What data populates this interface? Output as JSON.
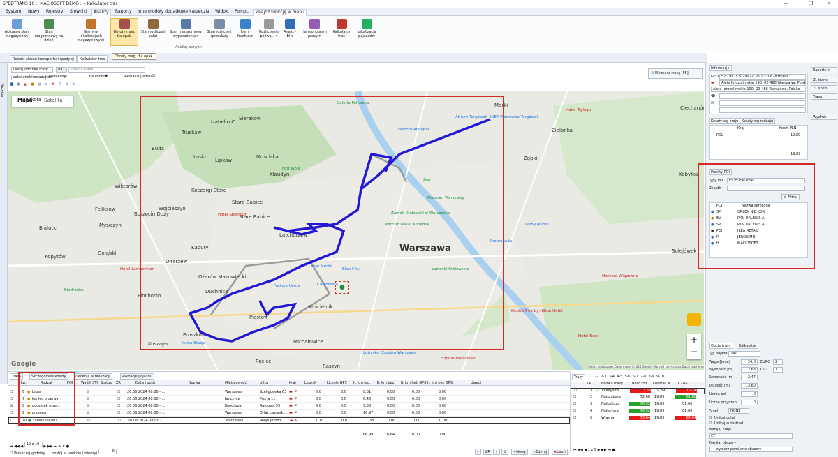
{
  "app": {
    "title": "SPEDTRANS 10 :: MACIOSOFT DEMO :: - Kalkulator tras"
  },
  "menu": {
    "tabs": [
      "System",
      "Nowy",
      "Rejestry",
      "Słowniki",
      "Analizy",
      "Raporty",
      "Inne moduły dodatkowe",
      "Narzędzia",
      "Widok",
      "Pomoc",
      "Znajdź funkcję w menu"
    ],
    "active": "Analizy"
  },
  "ribbon": {
    "buttons": [
      {
        "label": "Aktualny stan magazynowy",
        "icon": "warehouse-icon"
      },
      {
        "label": "Stan magazynowy na dzień",
        "icon": "calendar-warehouse-icon"
      },
      {
        "label": "Stany w lokalizacjach magazynowych",
        "icon": "locations-icon"
      },
      {
        "label": "Obroty mag. dla opak.",
        "icon": "package-turnover-icon"
      },
      {
        "label": "Stan rozliczeń palet",
        "icon": "pallet-icon"
      },
      {
        "label": "Stan magazynowy wyposażenia ▾",
        "icon": "equipment-icon"
      },
      {
        "label": "Stan rozliczeń sprzedaży",
        "icon": "sales-settlement-icon"
      },
      {
        "label": "Ceny frachtów",
        "icon": "freight-price-icon"
      },
      {
        "label": "Rozliczenie paliwa... ▾",
        "icon": "fuel-icon"
      },
      {
        "label": "Analizy BI ▾",
        "icon": "bi-icon"
      },
      {
        "label": "Harmonogram pracy ▾",
        "icon": "schedule-icon"
      },
      {
        "label": "Kalkulator tras",
        "icon": "route-calculator-icon"
      },
      {
        "label": "Lokalizacja pojazdów",
        "icon": "vehicle-location-icon"
      }
    ],
    "group_label": "Analizy danych",
    "tooltip": "Obroty mag. dla opak."
  },
  "doc_tabs": [
    "Rejestr zleceń transportu i spedycji",
    "Kalkulator tras"
  ],
  "left_strip_label": "Pojazdy",
  "route_toolbar": {
    "add_point": "Dodaj odcinek trasy",
    "search_placeholder": "Znajdź adres",
    "mode": "załadunek/rozładunek",
    "option_between": "pomiędzy",
    "option_end": "na końcu",
    "update_address": "Aktualizuj adres",
    "calc_button": "Wyznacz trasę [F5]"
  },
  "map": {
    "tab_map": "Mapa",
    "tab_satellite": "Satelita",
    "main_city": "Warszawa",
    "attribution": "Skróty klawiszowe   Dane mapy ©2024 Google   Warunki korzystania   Zgłoś błąd w mapach",
    "google": "Google",
    "labels": [
      {
        "t": "Rozkoła"
      },
      {
        "t": "Truskaw"
      },
      {
        "t": "Izabelin C"
      },
      {
        "t": "Sieraków"
      },
      {
        "t": "Laski"
      },
      {
        "t": "Lipków"
      },
      {
        "t": "Buda"
      },
      {
        "t": "Borzęcin Duży"
      },
      {
        "t": "Wojcieszyn"
      },
      {
        "t": "Stare Babice"
      },
      {
        "t": "Klaudyn"
      },
      {
        "t": "Koczargi Stare"
      },
      {
        "t": "Kaputy"
      },
      {
        "t": "Latchorzew"
      },
      {
        "t": "Ożarów Mazowiecki"
      },
      {
        "t": "Duchnice"
      },
      {
        "t": "Piastów"
      },
      {
        "t": "Pruszków"
      },
      {
        "t": "Michałowice"
      },
      {
        "t": "Raszyn"
      },
      {
        "t": "Kościelnik"
      },
      {
        "t": "Marki"
      },
      {
        "t": "Ząbki"
      },
      {
        "t": "Zielonka"
      },
      {
        "t": "Ciechanów"
      },
      {
        "t": "Kobyłka"
      },
      {
        "t": "Sulejówek"
      },
      {
        "t": "Wiktorów"
      },
      {
        "t": "Feliksów"
      },
      {
        "t": "Mysiczyn"
      },
      {
        "t": "Białutki"
      },
      {
        "t": "Kopytów"
      },
      {
        "t": "Płochocin"
      },
      {
        "t": "Koszajec"
      },
      {
        "t": "Pęcice"
      },
      {
        "t": "Stare Babice"
      },
      {
        "t": "Mościska"
      },
      {
        "t": "Ołtarzew"
      },
      {
        "t": "Gołąbki"
      }
    ],
    "pois": [
      {
        "t": "Biedronka"
      },
      {
        "t": "Hotel Splendor"
      },
      {
        "t": "Hotel Lambertson"
      },
      {
        "t": "Leroy Merlin"
      },
      {
        "t": "Factory Ursus"
      },
      {
        "t": "Castorama"
      },
      {
        "t": "Blue City"
      },
      {
        "t": "Zamek Królewski w Warszawie"
      },
      {
        "t": "Centrum Nauki Kopernik"
      },
      {
        "t": "Łazienki Królewskie"
      },
      {
        "t": "Factory Annopol"
      },
      {
        "t": "Atrium Targówek"
      },
      {
        "t": "IKEA Warszawa Targówek"
      },
      {
        "t": "Muzeum Warszawy"
      },
      {
        "t": "Promenada"
      },
      {
        "t": "Leroy Merlin"
      },
      {
        "t": "Fort Wola"
      },
      {
        "t": "Zoo"
      },
      {
        "t": "Nowa Stacja"
      },
      {
        "t": "Galeria Północna"
      },
      {
        "t": "Hotel Trylogia"
      },
      {
        "t": "Hotel Boss"
      },
      {
        "t": "DoubleTree by Hilton Hotel"
      },
      {
        "t": "Mercure Wiązowna"
      },
      {
        "t": "Szpital Medicover"
      },
      {
        "t": "Lotnisko Chopina Warszawa"
      }
    ]
  },
  "bottom": {
    "tabs": [
      "Trasa",
      "Szczegółowe koszty",
      "Zlecenia w realizacji",
      "Awizacje pojazdu"
    ],
    "columns": [
      "Lp.",
      "Rodzaj",
      "POI",
      "Wyślij STI",
      "Status",
      "ZR",
      "Data i godz.",
      "Nazwa",
      "Miejscowość",
      "Ulica",
      "Kraj",
      "Licznik",
      "Licznik GPS",
      "Ił. km lad.",
      "Ił. km bez.",
      "Ił. km lad. GPS",
      "Ił. km bez GPS",
      "Uwagi"
    ],
    "rows": [
      {
        "lp": "6",
        "rodzaj": "baza",
        "data": "26.06.2024 08:00 - ...",
        "miejsc": "Warszawa",
        "ulica": "Szeligowska 63",
        "kraj": "P",
        "licz": "0,0",
        "gps": "0,0",
        "kmlad": "8,01",
        "kmbez": "0,00",
        "kmladgps": "0,00",
        "kmbezgps": "0,00"
      },
      {
        "lp": "7",
        "rodzaj": "koniec przerwy",
        "data": "26.06.2024 08:00 - ...",
        "miejsc": "Janczyce",
        "ulica": "Pruna 11",
        "kraj": "P",
        "licz": "0,0",
        "gps": "0,0",
        "kmlad": "6,48",
        "kmbez": "0,00",
        "kmladgps": "0,00",
        "kmbezgps": "0,00"
      },
      {
        "lp": "8",
        "rodzaj": "początek prze...",
        "data": "26.06.2024 08:00 - ...",
        "miejsc": "Konotopa",
        "ulica": "Rajdowa 59",
        "kraj": "P",
        "licz": "0,0",
        "gps": "0,0",
        "kmlad": "9,38",
        "kmbez": "0,00",
        "kmladgps": "0,00",
        "kmbezgps": "0,00"
      },
      {
        "lp": "9",
        "rodzaj": "przerwa",
        "data": "26.06.2024 08:00 - ...",
        "miejsc": "Warszawa",
        "ulica": "Orląt Lwowski...",
        "kraj": "P",
        "licz": "0,0",
        "gps": "0,0",
        "kmlad": "10,97",
        "kmbez": "0,00",
        "kmladgps": "0,00",
        "kmbezgps": "0,00"
      },
      {
        "lp": "10",
        "rodzaj": "załadunek/roz...",
        "data": "26.06.2024 08:00 - ...",
        "miejsc": "Warszawa",
        "ulica": "Aleje Jerozol...",
        "kraj": "P",
        "licz": "0,0",
        "gps": "0,0",
        "kmlad": "11,33",
        "kmbez": "0,00",
        "kmladgps": "0,00",
        "kmbezgps": "0,00"
      }
    ],
    "sum": {
      "kmlad": "66,99",
      "kmbez": "6,64",
      "kmladgps": "0,00",
      "kmbezgps": "0,00"
    },
    "pager": "10 z 10",
    "footer_label": "Przeliczaj godziny",
    "footer_label2": "postój w punkcie (minuty)",
    "footer_value": "0",
    "buttons": {
      "new": "Nowy",
      "edit": "Edytuj",
      "delete": "Usuń"
    }
  },
  "trasy": {
    "title": "Trasy",
    "subtabs": [
      "1-2",
      "2-3",
      "3-4",
      "4-5",
      "5-6",
      "6-7",
      "7-8",
      "8-9",
      "9-10"
    ],
    "columns": [
      "LP",
      "Nazwa trasy",
      "Bość km",
      "Koszt PLN",
      "CZAS"
    ],
    "rows": [
      {
        "lp": "1",
        "name": "Domyślna",
        "km": "73,68",
        "cost": "19,89",
        "time": "02:04",
        "kmcolor": "red",
        "timecolor": "red"
      },
      {
        "lp": "2",
        "name": "Najszybsza",
        "km": "72,68",
        "cost": "19,89",
        "time": "01:60",
        "kmcolor": "none",
        "timecolor": "green"
      },
      {
        "lp": "3",
        "name": "Najkrótsza",
        "km": "70,92",
        "cost": "19,89",
        "time": "01:60",
        "kmcolor": "green",
        "timecolor": "none"
      },
      {
        "lp": "4",
        "name": "Najtańsza",
        "km": "70,92",
        "cost": "19,89",
        "time": "01:60",
        "kmcolor": "green",
        "timecolor": "none"
      },
      {
        "lp": "5",
        "name": "Własna",
        "km": "73,64",
        "cost": "19,89",
        "time": "02:04",
        "kmcolor": "red",
        "timecolor": "red"
      }
    ],
    "pager": "1 z 5"
  },
  "right": {
    "info_tab": "Informacje",
    "geo": "52.198753029927, 20.932062836963",
    "address1": "Aleje Jerozolimskie 190, 02-486 Warszawa, Polska",
    "address2": "Aleje Jerozolimskie 190, 02-486 Warszawa, Polska",
    "geo_label": "GEO",
    "costs_tabs": [
      "Koszty wg kraju",
      "Koszty wg rodzaju"
    ],
    "cost_cols": [
      "Kraj",
      "Koszt PLN"
    ],
    "cost_row": {
      "kraj": "POL",
      "koszt": "19,89"
    },
    "cost_total": "19,89",
    "side_buttons": [
      "Raporty ▾",
      "Zl. trans",
      "Zl. sped",
      "Trasa",
      "Wydruk"
    ],
    "poi_tab": "Punkty POI",
    "poi_type_label": "Typy POI",
    "poi_type_value": "EV;H;P;POI;SP",
    "find_label": "Znajdź",
    "filter_button": "Filtruj",
    "poi_cols": [
      "POI",
      "Nazwa skrócona"
    ],
    "poi_rows": [
      {
        "poi": "SP",
        "name": "ORLEN NIE KOR"
      },
      {
        "poi": "EV",
        "name": "PKN ORLEN S.A."
      },
      {
        "poi": "SP",
        "name": "PKN ORLEN S.A."
      },
      {
        "poi": "POI",
        "name": "IKEA RETAIL"
      },
      {
        "poi": "P",
        "name": "JERONIMO"
      },
      {
        "poi": "H",
        "name": "MACIOSOFT"
      }
    ],
    "options_tabs": [
      "Opcje trasy",
      "Kalkulator"
    ],
    "options": {
      "vehicle_type_label": "Typ pojazdu",
      "vehicle_type": "24T",
      "weight_label": "Waga [tona]",
      "weight": "24,0",
      "euro_label": "EURO",
      "euro": "2",
      "height_label": "Wysokość [m]",
      "height": "2,63",
      "co2_label": "CO2",
      "co2": "1",
      "width_label": "Szerokość [m]",
      "width": "2,47",
      "length_label": "Długość [m]",
      "length": "13,60",
      "axles_label": "Liczba osi",
      "axles": "2",
      "trailers_label": "Liczba przyczep",
      "trailers": "0",
      "tunnel_label": "Tunel",
      "tunnel": "NONE",
      "avoid_toll": "Unikaj opłat",
      "avoid_highway": "Unikaj autostrad",
      "avoid_countries_label": "Pomijaj kraje",
      "avoid_countries": "CY",
      "avoid_areas_label": "Pomijaj obszary",
      "avoid_areas": "--- wybierz pomijane obszary ---"
    }
  }
}
